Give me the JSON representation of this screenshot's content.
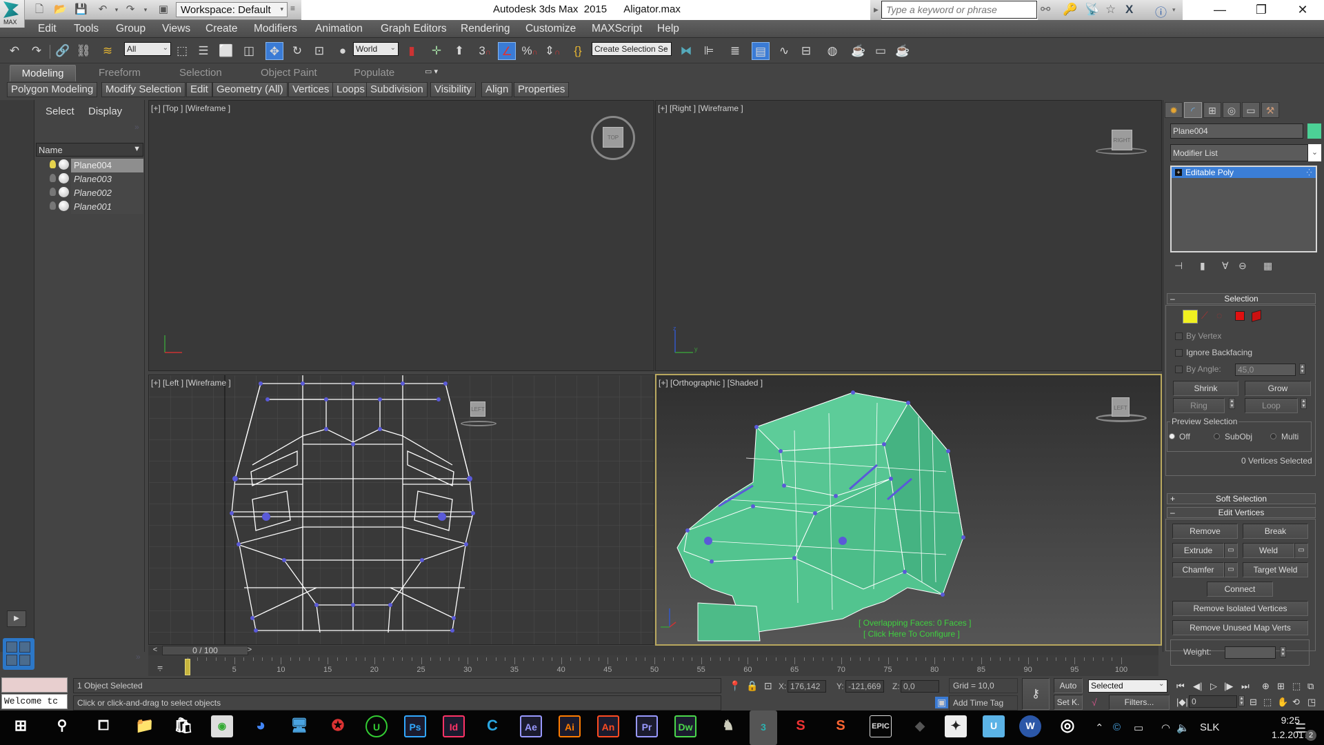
{
  "window": {
    "app_title": "Autodesk 3ds Max  2015",
    "file_name": "Aligator.max",
    "logo_label": "MAX",
    "workspace": "Workspace: Default",
    "search_placeholder": "Type a keyword or phrase",
    "controls": {
      "minimize": "—",
      "maximize": "❐",
      "close": "✕"
    }
  },
  "menu": [
    "Edit",
    "Tools",
    "Group",
    "Views",
    "Create",
    "Modifiers",
    "Animation",
    "Graph Editors",
    "Rendering",
    "Customize",
    "MAXScript",
    "Help"
  ],
  "toolbar": {
    "selection_filter": "All",
    "reference_coord": "World",
    "named_selection": "Create Selection Se",
    "snap_label": "3",
    "active_tool": "select-and-move"
  },
  "ribbon": {
    "tabs": [
      "Modeling",
      "Freeform",
      "Selection",
      "Object Paint",
      "Populate"
    ],
    "active_tab": "Modeling",
    "panels": [
      "Polygon Modeling",
      "Modify Selection",
      "Edit",
      "Geometry (All)",
      "Vertices",
      "Loops",
      "Subdivision",
      "Visibility",
      "Align",
      "Properties"
    ]
  },
  "scene_explorer": {
    "tabs": [
      "Select",
      "Display"
    ],
    "column": "Name",
    "objects": [
      {
        "name": "Plane004",
        "selected": true,
        "light_on": true
      },
      {
        "name": "Plane003",
        "selected": false,
        "light_on": false
      },
      {
        "name": "Plane002",
        "selected": false,
        "light_on": false
      },
      {
        "name": "Plane001",
        "selected": false,
        "light_on": false
      }
    ]
  },
  "viewports": {
    "top": {
      "label": "[+] [Top ] [Wireframe ]",
      "cube": "TOP"
    },
    "right": {
      "label": "[+] [Right ] [Wireframe ]",
      "cube": "RIGHT"
    },
    "left": {
      "label": "[+] [Left ] [Wireframe ]",
      "cube": "LEFT"
    },
    "persp": {
      "label": "[+] [Orthographic ] [Shaded ]",
      "cube": "LEFT",
      "overlay_line1": "[ Overlapping Faces: 0 Faces ]",
      "overlay_line2": "[ Click Here To Configure ]",
      "mesh_color": "#52c48f"
    }
  },
  "command_panel": {
    "object_name": "Plane004",
    "object_color": "#4cd196",
    "modifier_list": "Modifier List",
    "stack": [
      "Editable Poly"
    ],
    "selection": {
      "title": "Selection",
      "by_vertex": "By Vertex",
      "ignore_backfacing": "Ignore Backfacing",
      "by_angle": "By Angle:",
      "angle_value": "45,0",
      "shrink": "Shrink",
      "grow": "Grow",
      "ring": "Ring",
      "loop": "Loop",
      "preview_title": "Preview Selection",
      "preview_options": [
        "Off",
        "SubObj",
        "Multi"
      ],
      "preview_selected": "Off",
      "status": "0 Vertices Selected"
    },
    "soft_selection": {
      "title": "Soft Selection",
      "collapsed": true
    },
    "edit_vertices": {
      "title": "Edit Vertices",
      "remove": "Remove",
      "break": "Break",
      "extrude": "Extrude",
      "weld": "Weld",
      "chamfer": "Chamfer",
      "target_weld": "Target Weld",
      "connect": "Connect",
      "remove_isolated": "Remove Isolated Vertices",
      "remove_unused": "Remove Unused Map Verts",
      "weight_label": "Weight:",
      "weight_value": ""
    }
  },
  "timeline": {
    "slider": "0 / 100",
    "current_frame": 0,
    "ticks": [
      "0",
      "5",
      "10",
      "15",
      "20",
      "25",
      "30",
      "35",
      "40",
      "45",
      "50",
      "55",
      "60",
      "65",
      "70",
      "75",
      "80",
      "85",
      "90",
      "95",
      "100"
    ]
  },
  "status": {
    "maxscript_output": "Welcome tc",
    "selection_info": "1 Object Selected",
    "prompt": "Click or click-and-drag to select objects",
    "x_label": "X:",
    "x": "176,142",
    "y_label": "Y:",
    "y": "-121,669",
    "z_label": "Z:",
    "z": "0,0",
    "grid": "Grid = 10,0",
    "add_time_tag": "Add Time Tag",
    "auto": "Auto",
    "set_key": "Set K.",
    "key_filter": "Selected",
    "filters": "Filters...",
    "frame_field": "0"
  },
  "taskbar": {
    "apps": [
      {
        "name": "Ps",
        "color": "#31a8ff"
      },
      {
        "name": "Id",
        "color": "#ff3366"
      },
      {
        "name": "Ae",
        "color": "#9999ff"
      },
      {
        "name": "Ai",
        "color": "#ff7c00"
      },
      {
        "name": "An",
        "color": "#ff4b22"
      },
      {
        "name": "Pr",
        "color": "#9999ff"
      },
      {
        "name": "Dw",
        "color": "#4bd94b"
      }
    ],
    "language": "SLK",
    "time": "9:25",
    "date": "1.2.2017",
    "notifications": "2"
  }
}
